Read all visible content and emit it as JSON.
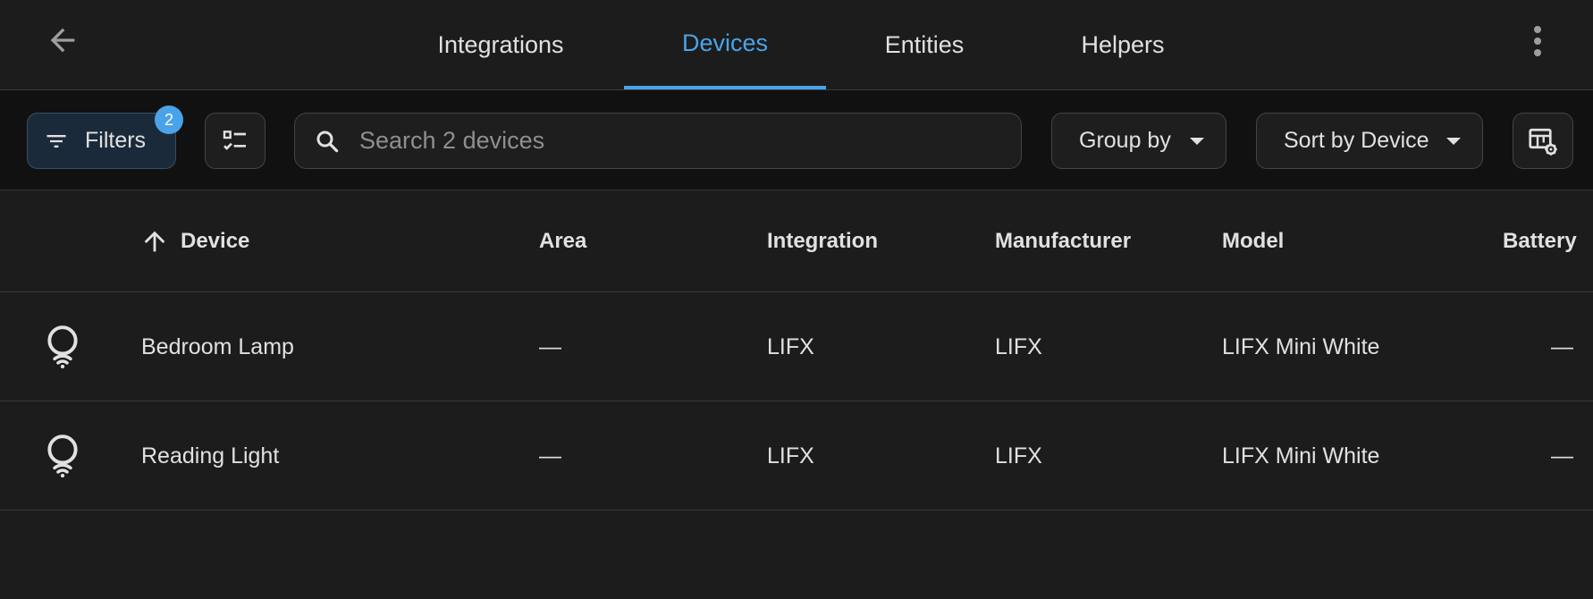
{
  "header": {
    "tabs": [
      {
        "label": "Integrations",
        "active": false
      },
      {
        "label": "Devices",
        "active": true
      },
      {
        "label": "Entities",
        "active": false
      },
      {
        "label": "Helpers",
        "active": false
      }
    ],
    "icons": {
      "back": "arrow-left-icon",
      "overflow": "dots-vertical-icon"
    }
  },
  "toolbar": {
    "filters_label": "Filters",
    "filters_badge": "2",
    "search_placeholder": "Search 2 devices",
    "search_value": "",
    "group_by_label": "Group by",
    "sort_label": "Sort by Device",
    "icons": {
      "filter": "filter-variant-icon",
      "select": "format-list-checks-icon",
      "search": "magnify-icon",
      "settings": "table-cog-icon"
    }
  },
  "table": {
    "sort_direction": "ascending",
    "columns": [
      "Device",
      "Area",
      "Integration",
      "Manufacturer",
      "Model",
      "Battery"
    ],
    "rows": [
      {
        "icon": "lightbulb-wifi-icon",
        "device": "Bedroom Lamp",
        "area": "—",
        "integration": "LIFX",
        "manufacturer": "LIFX",
        "model": "LIFX Mini White",
        "battery": "—"
      },
      {
        "icon": "lightbulb-wifi-icon",
        "device": "Reading Light",
        "area": "—",
        "integration": "LIFX",
        "manufacturer": "LIFX",
        "model": "LIFX Mini White",
        "battery": "—"
      }
    ]
  },
  "colors": {
    "accent": "#4aa3e8",
    "background": "#1c1c1c",
    "toolbar_background": "#111111",
    "text": "#e1e1e1"
  }
}
